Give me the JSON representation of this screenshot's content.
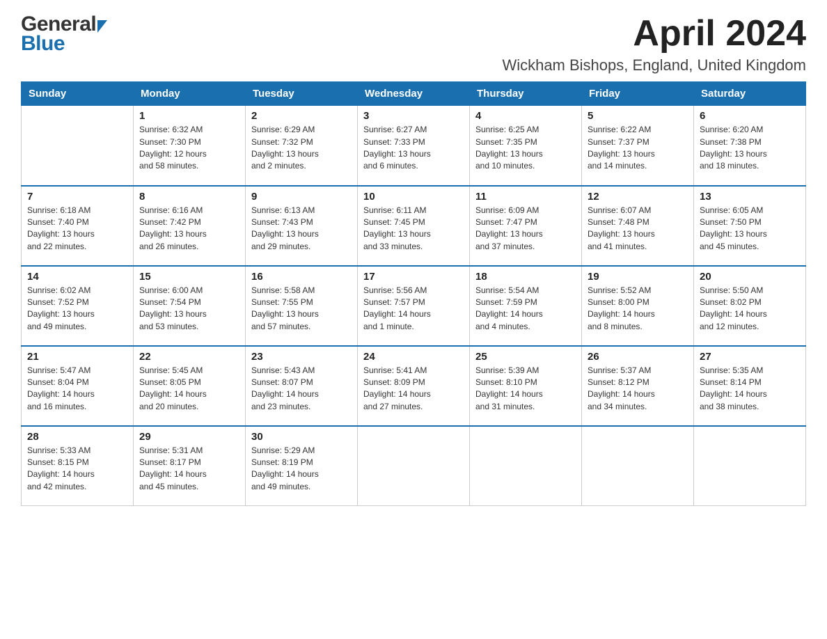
{
  "header": {
    "month_title": "April 2024",
    "location": "Wickham Bishops, England, United Kingdom",
    "logo_general": "General",
    "logo_blue": "Blue"
  },
  "days_of_week": [
    "Sunday",
    "Monday",
    "Tuesday",
    "Wednesday",
    "Thursday",
    "Friday",
    "Saturday"
  ],
  "weeks": [
    [
      {
        "day": "",
        "info": []
      },
      {
        "day": "1",
        "info": [
          "Sunrise: 6:32 AM",
          "Sunset: 7:30 PM",
          "Daylight: 12 hours",
          "and 58 minutes."
        ]
      },
      {
        "day": "2",
        "info": [
          "Sunrise: 6:29 AM",
          "Sunset: 7:32 PM",
          "Daylight: 13 hours",
          "and 2 minutes."
        ]
      },
      {
        "day": "3",
        "info": [
          "Sunrise: 6:27 AM",
          "Sunset: 7:33 PM",
          "Daylight: 13 hours",
          "and 6 minutes."
        ]
      },
      {
        "day": "4",
        "info": [
          "Sunrise: 6:25 AM",
          "Sunset: 7:35 PM",
          "Daylight: 13 hours",
          "and 10 minutes."
        ]
      },
      {
        "day": "5",
        "info": [
          "Sunrise: 6:22 AM",
          "Sunset: 7:37 PM",
          "Daylight: 13 hours",
          "and 14 minutes."
        ]
      },
      {
        "day": "6",
        "info": [
          "Sunrise: 6:20 AM",
          "Sunset: 7:38 PM",
          "Daylight: 13 hours",
          "and 18 minutes."
        ]
      }
    ],
    [
      {
        "day": "7",
        "info": [
          "Sunrise: 6:18 AM",
          "Sunset: 7:40 PM",
          "Daylight: 13 hours",
          "and 22 minutes."
        ]
      },
      {
        "day": "8",
        "info": [
          "Sunrise: 6:16 AM",
          "Sunset: 7:42 PM",
          "Daylight: 13 hours",
          "and 26 minutes."
        ]
      },
      {
        "day": "9",
        "info": [
          "Sunrise: 6:13 AM",
          "Sunset: 7:43 PM",
          "Daylight: 13 hours",
          "and 29 minutes."
        ]
      },
      {
        "day": "10",
        "info": [
          "Sunrise: 6:11 AM",
          "Sunset: 7:45 PM",
          "Daylight: 13 hours",
          "and 33 minutes."
        ]
      },
      {
        "day": "11",
        "info": [
          "Sunrise: 6:09 AM",
          "Sunset: 7:47 PM",
          "Daylight: 13 hours",
          "and 37 minutes."
        ]
      },
      {
        "day": "12",
        "info": [
          "Sunrise: 6:07 AM",
          "Sunset: 7:48 PM",
          "Daylight: 13 hours",
          "and 41 minutes."
        ]
      },
      {
        "day": "13",
        "info": [
          "Sunrise: 6:05 AM",
          "Sunset: 7:50 PM",
          "Daylight: 13 hours",
          "and 45 minutes."
        ]
      }
    ],
    [
      {
        "day": "14",
        "info": [
          "Sunrise: 6:02 AM",
          "Sunset: 7:52 PM",
          "Daylight: 13 hours",
          "and 49 minutes."
        ]
      },
      {
        "day": "15",
        "info": [
          "Sunrise: 6:00 AM",
          "Sunset: 7:54 PM",
          "Daylight: 13 hours",
          "and 53 minutes."
        ]
      },
      {
        "day": "16",
        "info": [
          "Sunrise: 5:58 AM",
          "Sunset: 7:55 PM",
          "Daylight: 13 hours",
          "and 57 minutes."
        ]
      },
      {
        "day": "17",
        "info": [
          "Sunrise: 5:56 AM",
          "Sunset: 7:57 PM",
          "Daylight: 14 hours",
          "and 1 minute."
        ]
      },
      {
        "day": "18",
        "info": [
          "Sunrise: 5:54 AM",
          "Sunset: 7:59 PM",
          "Daylight: 14 hours",
          "and 4 minutes."
        ]
      },
      {
        "day": "19",
        "info": [
          "Sunrise: 5:52 AM",
          "Sunset: 8:00 PM",
          "Daylight: 14 hours",
          "and 8 minutes."
        ]
      },
      {
        "day": "20",
        "info": [
          "Sunrise: 5:50 AM",
          "Sunset: 8:02 PM",
          "Daylight: 14 hours",
          "and 12 minutes."
        ]
      }
    ],
    [
      {
        "day": "21",
        "info": [
          "Sunrise: 5:47 AM",
          "Sunset: 8:04 PM",
          "Daylight: 14 hours",
          "and 16 minutes."
        ]
      },
      {
        "day": "22",
        "info": [
          "Sunrise: 5:45 AM",
          "Sunset: 8:05 PM",
          "Daylight: 14 hours",
          "and 20 minutes."
        ]
      },
      {
        "day": "23",
        "info": [
          "Sunrise: 5:43 AM",
          "Sunset: 8:07 PM",
          "Daylight: 14 hours",
          "and 23 minutes."
        ]
      },
      {
        "day": "24",
        "info": [
          "Sunrise: 5:41 AM",
          "Sunset: 8:09 PM",
          "Daylight: 14 hours",
          "and 27 minutes."
        ]
      },
      {
        "day": "25",
        "info": [
          "Sunrise: 5:39 AM",
          "Sunset: 8:10 PM",
          "Daylight: 14 hours",
          "and 31 minutes."
        ]
      },
      {
        "day": "26",
        "info": [
          "Sunrise: 5:37 AM",
          "Sunset: 8:12 PM",
          "Daylight: 14 hours",
          "and 34 minutes."
        ]
      },
      {
        "day": "27",
        "info": [
          "Sunrise: 5:35 AM",
          "Sunset: 8:14 PM",
          "Daylight: 14 hours",
          "and 38 minutes."
        ]
      }
    ],
    [
      {
        "day": "28",
        "info": [
          "Sunrise: 5:33 AM",
          "Sunset: 8:15 PM",
          "Daylight: 14 hours",
          "and 42 minutes."
        ]
      },
      {
        "day": "29",
        "info": [
          "Sunrise: 5:31 AM",
          "Sunset: 8:17 PM",
          "Daylight: 14 hours",
          "and 45 minutes."
        ]
      },
      {
        "day": "30",
        "info": [
          "Sunrise: 5:29 AM",
          "Sunset: 8:19 PM",
          "Daylight: 14 hours",
          "and 49 minutes."
        ]
      },
      {
        "day": "",
        "info": []
      },
      {
        "day": "",
        "info": []
      },
      {
        "day": "",
        "info": []
      },
      {
        "day": "",
        "info": []
      }
    ]
  ]
}
